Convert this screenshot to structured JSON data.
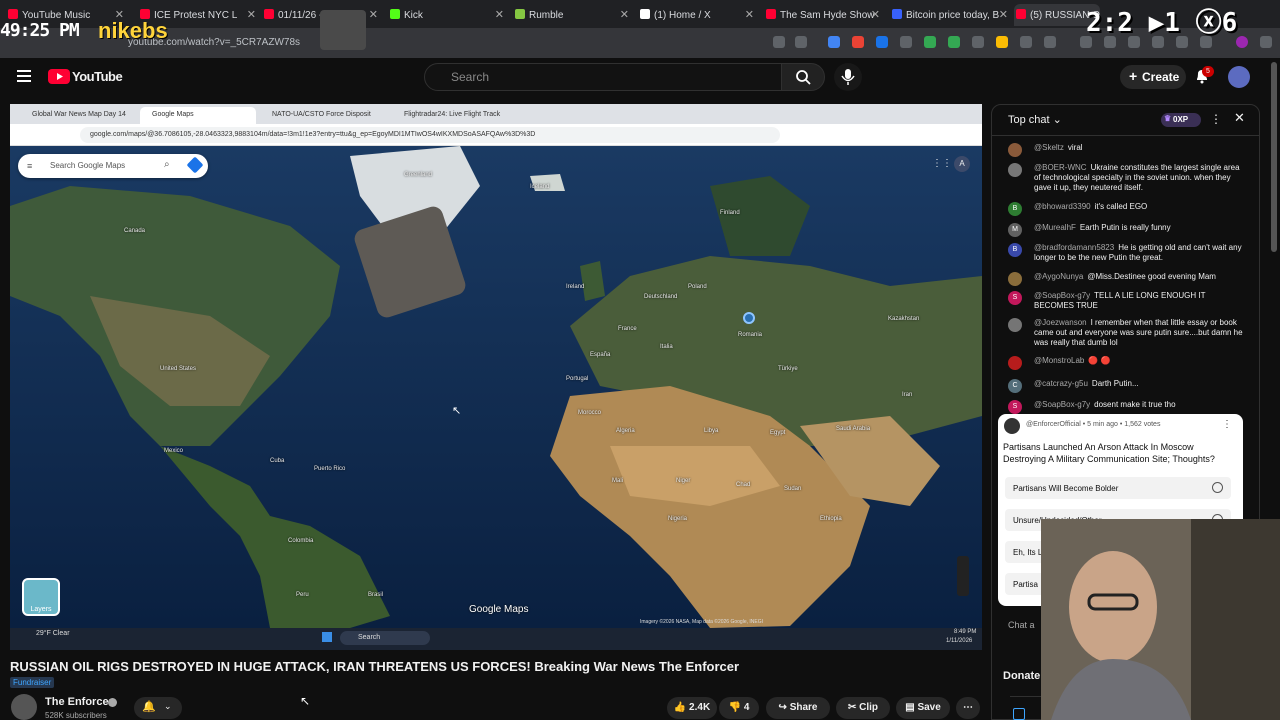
{
  "browser": {
    "tabs": [
      {
        "label": "YouTube Music",
        "active": false,
        "color": "#ff0033"
      },
      {
        "label": "ICE Protest NYC L",
        "active": false,
        "color": "#ff0033"
      },
      {
        "label": "01/11/26 - I",
        "active": false,
        "color": "#ff0033"
      },
      {
        "label": "Kick",
        "active": false,
        "color": "#53fc18"
      },
      {
        "label": "Rumble",
        "active": false,
        "color": "#85c742"
      },
      {
        "label": "(1) Home / X",
        "active": false,
        "color": "#ffffff"
      },
      {
        "label": "The Sam Hyde Show",
        "active": false,
        "color": "#ff0033"
      },
      {
        "label": "Bitcoin price today, B",
        "active": false,
        "color": "#3861fb"
      },
      {
        "label": "(5) RUSSIAN OIL",
        "active": true,
        "color": "#ff0033"
      }
    ],
    "url": "youtube.com/watch?v=_5CR7AZW78s"
  },
  "overlay": {
    "clock": "49:25 PM",
    "logo_text": "nikebs",
    "score_text": "2:2 ▶1 ⓧ6"
  },
  "youtube": {
    "logo_label": "YouTube",
    "search_placeholder": "Search",
    "create_label": "Create",
    "notification_count": "5"
  },
  "video": {
    "inner_tabs": [
      "Global War News Map Day 14",
      "Google Maps",
      "NATO-UA/CSTO Force Disposit",
      "Flightradar24: Live Flight Track"
    ],
    "inner_url": "google.com/maps/@36.7086105,-28.0463323,9883104m/data=!3m1!1e3?entry=ttu&g_ep=EgoyMDI1MTIwOS4wIKXMDSoASAFQAw%3D%3D",
    "maps_search_placeholder": "Search Google Maps",
    "layers_label": "Layers",
    "google_maps_label": "Google Maps",
    "map_labels": [
      {
        "text": "Greenland"
      },
      {
        "text": "Canada"
      },
      {
        "text": "United States"
      },
      {
        "text": "Mexico"
      },
      {
        "text": "Cuba"
      },
      {
        "text": "Puerto Rico"
      },
      {
        "text": "Colombia"
      },
      {
        "text": "Brasil"
      },
      {
        "text": "Peru"
      },
      {
        "text": "Iceland"
      },
      {
        "text": "Finland"
      },
      {
        "text": "Ireland"
      },
      {
        "text": "Poland"
      },
      {
        "text": "Deutschland"
      },
      {
        "text": "France"
      },
      {
        "text": "España"
      },
      {
        "text": "Portugal"
      },
      {
        "text": "Italia"
      },
      {
        "text": "Romania"
      },
      {
        "text": "Kazakhstan"
      },
      {
        "text": "Türkiye"
      },
      {
        "text": "Morocco"
      },
      {
        "text": "Algeria"
      },
      {
        "text": "Libya"
      },
      {
        "text": "Egypt"
      },
      {
        "text": "Mali"
      },
      {
        "text": "Niger"
      },
      {
        "text": "Chad"
      },
      {
        "text": "Sudan"
      },
      {
        "text": "Nigeria"
      },
      {
        "text": "Ethiopia"
      },
      {
        "text": "Saudi Arabia"
      },
      {
        "text": "Iran"
      }
    ],
    "taskbar": {
      "weather": "29°F Clear",
      "search": "Search",
      "time": "8:49 PM",
      "date": "1/11/2026"
    },
    "imagery_credit": "Imagery ©2026 NASA, Map data ©2026 Google, INEGI"
  },
  "meta": {
    "title": "RUSSIAN OIL RIGS DESTROYED IN HUGE ATTACK, IRAN THREATENS US FORCES! Breaking War News The Enforcer",
    "fundraiser_label": "Fundraiser",
    "channel_name": "The Enforcer",
    "subscribers": "528K subscribers",
    "like_count": "2.4K",
    "dislike_count": "4",
    "share_label": "Share",
    "clip_label": "Clip",
    "save_label": "Save"
  },
  "chat": {
    "title": "Top chat",
    "xp_badge": "0XP",
    "messages": [
      {
        "author": "@Skeltz",
        "text": "viral",
        "avatar_color": "#8a5a3a"
      },
      {
        "author": "@BOER-WNC",
        "text": "Ukraine constitutes the largest single area of technological specialty in the soviet union. when they gave it up, they neutered itself.",
        "avatar_color": "#777777"
      },
      {
        "author": "@bhoward3390",
        "text": "it's called EGO",
        "avatar_color": "#2e7d32",
        "initial": "B"
      },
      {
        "author": "@MurealhF",
        "text": "Earth Putin is really funny",
        "avatar_color": "#616161",
        "initial": "M"
      },
      {
        "author": "@bradfordamann5823",
        "text": "He is getting old and can't wait any longer to be the new Putin the great.",
        "avatar_color": "#3949ab",
        "initial": "B"
      },
      {
        "author": "@AygoNunya",
        "text": "@Miss.Destinee good evening Mam",
        "avatar_color": "#8a6d3b"
      },
      {
        "author": "@SoapBox-g7y",
        "text": "TELL A LIE LONG ENOUGH IT BECOMES TRUE",
        "avatar_color": "#c2185b",
        "initial": "S"
      },
      {
        "author": "@Joezwanson",
        "text": "I remember when that little essay or book came out and everyone was sure putin sure....but damn he was really that dumb lol",
        "avatar_color": "#757575"
      },
      {
        "author": "@MonstroLab",
        "text": "🔴 🔴",
        "avatar_color": "#b71c1c"
      },
      {
        "author": "@catcrazy-g5u",
        "text": "Darth Putin...",
        "avatar_color": "#546e7a",
        "initial": "C"
      },
      {
        "author": "@SoapBox-g7y",
        "text": "dosent make it true tho",
        "avatar_color": "#c2185b",
        "initial": "S"
      }
    ],
    "poll": {
      "meta": "@EnforcerOfficial • 5 min ago • 1,562 votes",
      "question": "Partisans Launched An Arson Attack In Moscow Destroying A Military Communication Site; Thoughts?",
      "options": [
        "Partisans Will Become Bolder",
        "Unsure/Undecided/Other",
        "Eh, Its L",
        "Partisa"
      ]
    },
    "input_placeholder": "Chat a",
    "donate_label": "Donate"
  },
  "colors": {
    "yt_red": "#ff0033",
    "bg": "#0f0f0f",
    "link_blue": "#3ea6ff"
  }
}
